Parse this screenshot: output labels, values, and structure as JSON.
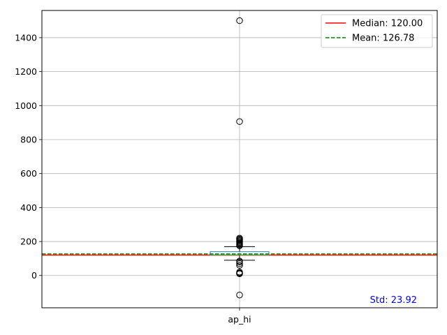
{
  "chart_data": {
    "type": "box",
    "categories": [
      "ap_hi"
    ],
    "ylim": [
      -190,
      1560
    ],
    "yticks": [
      0,
      200,
      400,
      600,
      800,
      1000,
      1200,
      1400
    ],
    "grid": true,
    "box": {
      "name": "ap_hi",
      "q1": 120,
      "median": 120,
      "q3": 140,
      "whisker_low": 90,
      "whisker_high": 170,
      "outliers": [
        1500,
        906,
        220,
        215,
        210,
        205,
        200,
        195,
        190,
        185,
        180,
        175,
        85,
        80,
        70,
        60,
        20,
        15,
        14,
        12,
        10,
        -115
      ]
    },
    "reference_lines": [
      {
        "label": "Median: 120.00",
        "value": 120.0,
        "color": "#ff0000",
        "style": "solid"
      },
      {
        "label": "Mean: 126.78",
        "value": 126.78,
        "color": "#008000",
        "style": "dashed"
      }
    ],
    "legend_position": "top-right",
    "annotation": {
      "text": "Std: 23.92",
      "color": "#0000ff",
      "position": "bottom-right"
    },
    "box_color": "#1f77b4"
  }
}
